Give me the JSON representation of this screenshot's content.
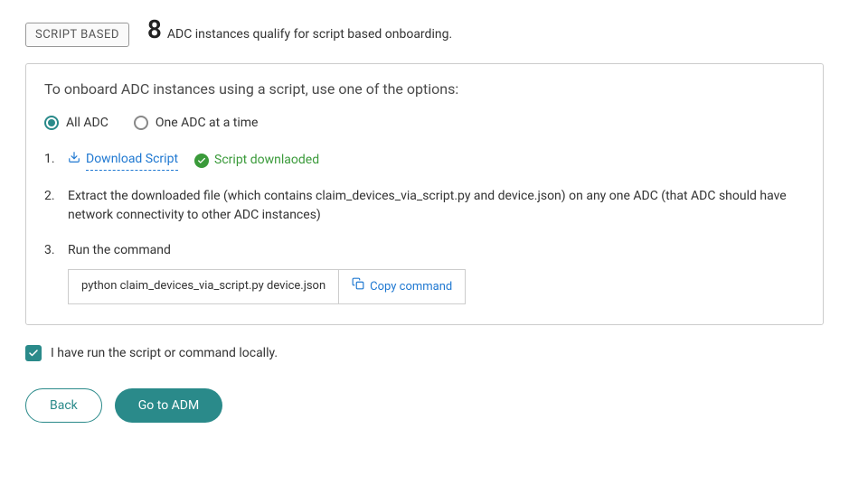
{
  "header": {
    "badge": "SCRIPT BASED",
    "count": "8",
    "count_suffix": "ADC instances qualify for script based onboarding."
  },
  "panel": {
    "title": "To onboard ADC instances using a script, use one of the options:",
    "radio": {
      "all_adc": "All ADC",
      "one_adc": "One ADC at a time",
      "selected": "all_adc"
    },
    "steps": {
      "s1_num": "1.",
      "s1_link": "Download Script",
      "s1_status": "Script downlaoded",
      "s2_num": "2.",
      "s2_text": "Extract the downloaded file (which contains claim_devices_via_script.py and device.json) on any one ADC (that ADC should have network connectivity to other ADC instances)",
      "s3_num": "3.",
      "s3_label": "Run the command",
      "s3_command": "python claim_devices_via_script.py device.json",
      "s3_copy": "Copy command"
    }
  },
  "confirm": {
    "label": "I have run the script or command locally.",
    "checked": true
  },
  "buttons": {
    "back": "Back",
    "go": "Go to ADM"
  }
}
